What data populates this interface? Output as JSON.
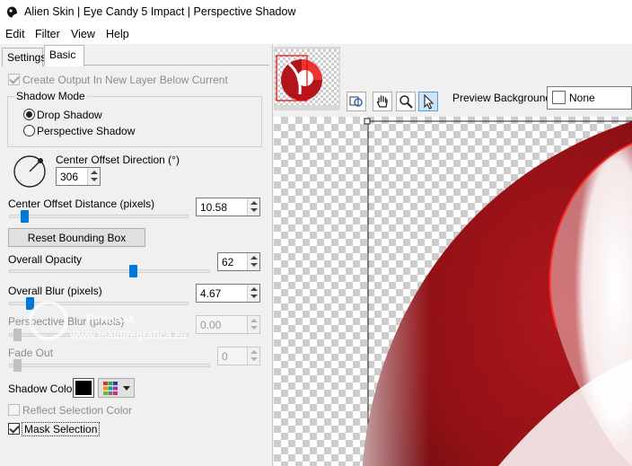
{
  "window": {
    "title": "Alien Skin | Eye Candy 5 Impact | Perspective Shadow"
  },
  "menu": [
    "Edit",
    "Filter",
    "View",
    "Help"
  ],
  "tabs": [
    {
      "label": "Settings",
      "active": false
    },
    {
      "label": "Basic",
      "active": true
    }
  ],
  "basic": {
    "create_output_label": "Create Output In New Layer Below Current",
    "shadow_mode": {
      "label": "Shadow Mode",
      "options": [
        "Drop Shadow",
        "Perspective Shadow"
      ],
      "selected": "Drop Shadow"
    },
    "center_offset_direction": {
      "label": "Center Offset Direction (°)",
      "value": "306"
    },
    "center_offset_distance": {
      "label": "Center Offset Distance (pixels)",
      "value": "10.58",
      "slider_fraction": 0.07
    },
    "reset_bounding_box_label": "Reset Bounding Box",
    "overall_opacity": {
      "label": "Overall Opacity",
      "value": "62",
      "slider_fraction": 0.62
    },
    "overall_blur": {
      "label": "Overall Blur (pixels)",
      "value": "4.67",
      "slider_fraction": 0.04
    },
    "perspective_blur": {
      "label": "Perspective Blur (pixels)",
      "value": "0.00",
      "slider_fraction": 0.0
    },
    "fade_out": {
      "label": "Fade Out",
      "value": "0",
      "slider_fraction": 0.0
    },
    "shadow_color": {
      "label": "Shadow Color",
      "color": "#000000"
    },
    "reflect_selection_color_label": "Reflect Selection Color",
    "mask_selection_label": "Mask Selection"
  },
  "preview": {
    "background_label": "Preview Background:",
    "background_value": "None"
  },
  "watermark": {
    "name": "Pinuccia",
    "url": "www.maidiregrafica.eu"
  },
  "colors": {
    "accent": "#0078d7",
    "preview_red": "#c0161c"
  }
}
